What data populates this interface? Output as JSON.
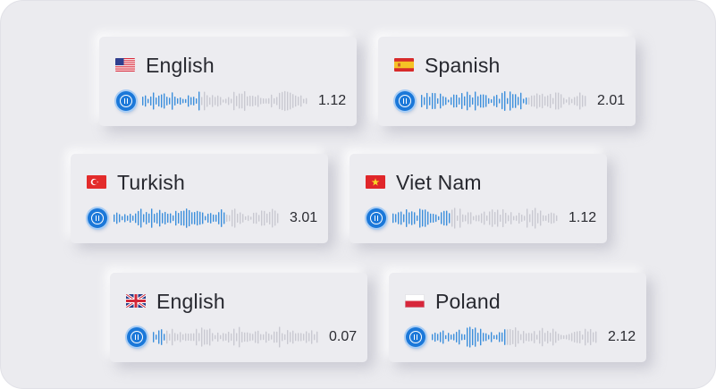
{
  "cards": [
    {
      "language": "English",
      "flag": "us-flag-icon",
      "time": "1.12",
      "progress": 0.35
    },
    {
      "language": "Spanish",
      "flag": "spain-flag-icon",
      "time": "2.01",
      "progress": 0.64
    },
    {
      "language": "Turkish",
      "flag": "turkey-flag-icon",
      "time": "3.01",
      "progress": 0.67
    },
    {
      "language": "Viet Nam",
      "flag": "vietnam-flag-icon",
      "time": "1.12",
      "progress": 0.34
    },
    {
      "language": "English",
      "flag": "uk-flag-icon",
      "time": "0.07",
      "progress": 0.08
    },
    {
      "language": "Poland",
      "flag": "poland-flag-icon",
      "time": "2.12",
      "progress": 0.44
    }
  ],
  "colors": {
    "played": "#3b8fdc",
    "unplayed": "#c9c9d1",
    "accent": "#1b78d9"
  },
  "icons": {
    "play_pause": "pause-icon"
  }
}
